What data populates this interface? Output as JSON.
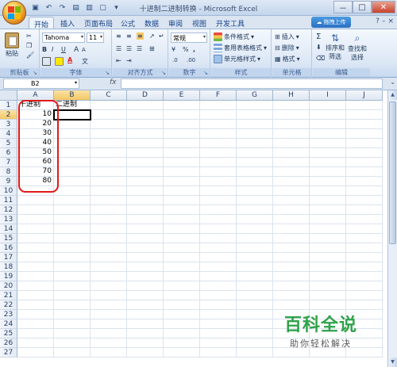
{
  "window": {
    "title": "十进制二进制转换 - Microsoft Excel",
    "qat_icons": [
      "save-icon",
      "undo-icon",
      "redo-icon",
      "open-icon",
      "print-icon",
      "new-icon",
      "customize-icon"
    ],
    "controls": [
      "－",
      "□",
      "✕"
    ]
  },
  "tabs": [
    "开始",
    "插入",
    "页面布局",
    "公式",
    "数据",
    "审阅",
    "视图",
    "开发工具"
  ],
  "active_tab": "开始",
  "upload_button": "拖拽上传",
  "ribbon": {
    "clipboard": {
      "paste": "粘贴",
      "label": "剪贴板"
    },
    "font": {
      "name": "Tahoma",
      "size": "11",
      "label": "字体",
      "size_up": "A",
      "size_down": "A",
      "bold": "B",
      "italic": "I",
      "underline": "U",
      "wen": "文",
      "font_color_glyph": "A"
    },
    "alignment": {
      "label": "对齐方式"
    },
    "number": {
      "format": "常规",
      "label": "数字",
      "currency": "¥",
      "percent": "%",
      "comma": ",",
      "dec_inc": ".0",
      "dec_dec": ".00"
    },
    "styles": {
      "conditional": "条件格式",
      "table": "套用表格格式",
      "cell": "单元格样式",
      "label": "样式"
    },
    "cells": {
      "insert": "插入",
      "delete": "删除",
      "format": "格式",
      "label": "单元格"
    },
    "editing": {
      "sum": "Σ",
      "sort": "排序和",
      "sort2": "筛选",
      "find": "查找和",
      "find2": "选择",
      "label": "编辑"
    }
  },
  "formula_bar": {
    "name_box": "B2",
    "fx": "fx",
    "formula": ""
  },
  "sheet": {
    "columns": [
      "A",
      "B",
      "C",
      "D",
      "E",
      "F",
      "G",
      "H",
      "I",
      "J"
    ],
    "rows": [
      "1",
      "2",
      "3",
      "4",
      "5",
      "6",
      "7",
      "8",
      "9",
      "10",
      "11",
      "12",
      "13",
      "14",
      "15",
      "16",
      "17",
      "18",
      "19",
      "20",
      "21",
      "22",
      "23",
      "24",
      "25",
      "26",
      "27"
    ],
    "A1": "十进制",
    "B1": "二进制",
    "values_A": [
      "10",
      "20",
      "30",
      "40",
      "50",
      "60",
      "70",
      "80"
    ],
    "selected_cell": "B2"
  },
  "watermark": {
    "main": "百科全说",
    "sub": "助你轻松解决"
  },
  "colors": {
    "accent": "#15428b",
    "highlight": "#e01a1a",
    "watermark": "#2fa24a"
  }
}
